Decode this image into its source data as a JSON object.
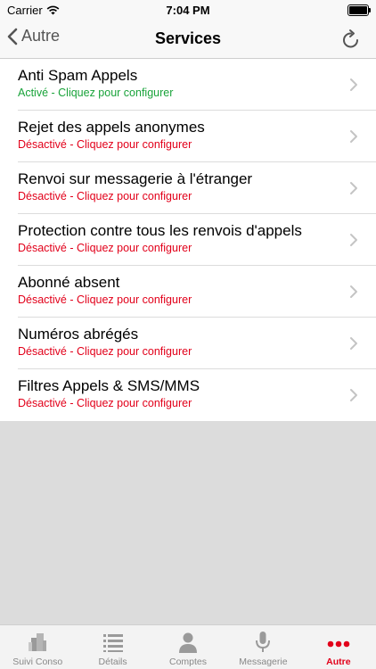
{
  "status_bar": {
    "carrier": "Carrier",
    "time": "7:04 PM"
  },
  "nav": {
    "back_label": "Autre",
    "title": "Services"
  },
  "colors": {
    "active": "#19a33a",
    "inactive": "#e2001a",
    "tab_active": "#e2001a"
  },
  "services": [
    {
      "title": "Anti Spam Appels",
      "status": "Activé - Cliquez pour configurer",
      "state": "active"
    },
    {
      "title": "Rejet des appels anonymes",
      "status": "Désactivé - Cliquez pour configurer",
      "state": "inactive"
    },
    {
      "title": "Renvoi sur messagerie à l'étranger",
      "status": "Désactivé - Cliquez pour configurer",
      "state": "inactive"
    },
    {
      "title": "Protection contre tous les renvois d'appels",
      "status": "Désactivé - Cliquez pour configurer",
      "state": "inactive"
    },
    {
      "title": "Abonné absent",
      "status": "Désactivé - Cliquez pour configurer",
      "state": "inactive"
    },
    {
      "title": "Numéros abrégés",
      "status": "Désactivé - Cliquez pour configurer",
      "state": "inactive"
    },
    {
      "title": "Filtres Appels & SMS/MMS",
      "status": "Désactivé - Cliquez pour configurer",
      "state": "inactive"
    }
  ],
  "tabs": [
    {
      "label": "Suivi Conso",
      "icon": "buildings-icon",
      "active": false
    },
    {
      "label": "Détails",
      "icon": "list-icon",
      "active": false
    },
    {
      "label": "Comptes",
      "icon": "person-icon",
      "active": false
    },
    {
      "label": "Messagerie",
      "icon": "microphone-icon",
      "active": false
    },
    {
      "label": "Autre",
      "icon": "more-dots-icon",
      "active": true
    }
  ]
}
